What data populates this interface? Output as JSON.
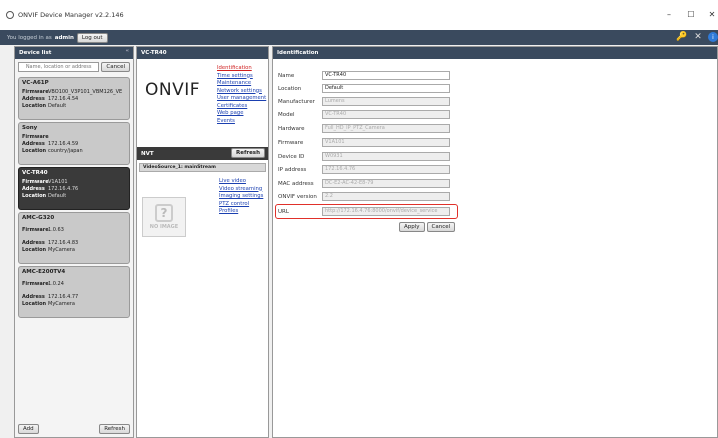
{
  "window": {
    "title": "ONVIF Device Manager v2.2.146",
    "minimize": "–",
    "maximize": "☐",
    "close": "✕"
  },
  "topbar": {
    "logged_in_prefix": "You logged in as",
    "user": "admin",
    "logout": "Log out"
  },
  "device_list": {
    "title": "Device list",
    "collapse": "«",
    "search_placeholder": "Name, location or address",
    "cancel": "Cancel",
    "add": "Add",
    "refresh": "Refresh",
    "devices": [
      {
        "name": "VC-A61P",
        "firmware": "VBO100_V3P101_VBM126_VE",
        "address": "172.16.4.54",
        "location": "Default",
        "selected": false
      },
      {
        "name": "Sony",
        "firmware": "",
        "address": "172.16.4.59",
        "location": "country/japan",
        "selected": false
      },
      {
        "name": "VC-TR40",
        "firmware": "V1A101",
        "address": "172.16.4.76",
        "location": "Default",
        "selected": true
      },
      {
        "name": "AMC-G320",
        "firmware": "1.0.63",
        "address": "172.16.4.83",
        "location": "MyCamera",
        "selected": false
      },
      {
        "name": "AMC-E200TV4",
        "firmware": "1.0.24",
        "address": "172.16.4.77",
        "location": "MyCamera",
        "selected": false
      }
    ],
    "labels": {
      "firmware": "Firmware",
      "address": "Address",
      "location": "Location"
    }
  },
  "device_panel": {
    "title": "VC-TR40",
    "logo": "ONVIF",
    "links": [
      "Identification",
      "Time settings",
      "Maintenance",
      "Network settings",
      "User management",
      "Certificates",
      "Web page",
      "Events"
    ],
    "nvt_title": "NVT",
    "nvt_refresh": "Refresh",
    "video_source": "VideoSource_1: mainStream",
    "nvt_links": [
      "Live video",
      "Video streaming",
      "Imaging settings",
      "PTZ control",
      "Profiles"
    ],
    "no_image": "NO IMAGE"
  },
  "identification": {
    "title": "Identification",
    "fields": [
      {
        "label": "Name",
        "value": "VC-TR40",
        "readonly": false
      },
      {
        "label": "Location",
        "value": "Default",
        "readonly": false
      },
      {
        "label": "Manufacturer",
        "value": "Lumens",
        "readonly": true
      },
      {
        "label": "Model",
        "value": "VC-TR40",
        "readonly": true
      },
      {
        "label": "Hardware",
        "value": "Full_HD_IP_PTZ_Camera",
        "readonly": true
      },
      {
        "label": "Firmware",
        "value": "V1A101",
        "readonly": true
      },
      {
        "label": "Device ID",
        "value": "W0931",
        "readonly": true
      },
      {
        "label": "IP address",
        "value": "172.16.4.76",
        "readonly": true
      },
      {
        "label": "MAC address",
        "value": "DC-E2-AC-42-E8-79",
        "readonly": true
      },
      {
        "label": "ONVIF version",
        "value": "2.2",
        "readonly": true
      },
      {
        "label": "URL",
        "value": "http://172.16.4.76:8000/onvif/device_service",
        "readonly": true
      }
    ],
    "apply": "Apply",
    "cancel": "Cancel"
  },
  "colors": {
    "header": "#3a4a5e",
    "highlight": "#e0302a",
    "link": "#1a3fb0",
    "link_active": "#d02020"
  }
}
